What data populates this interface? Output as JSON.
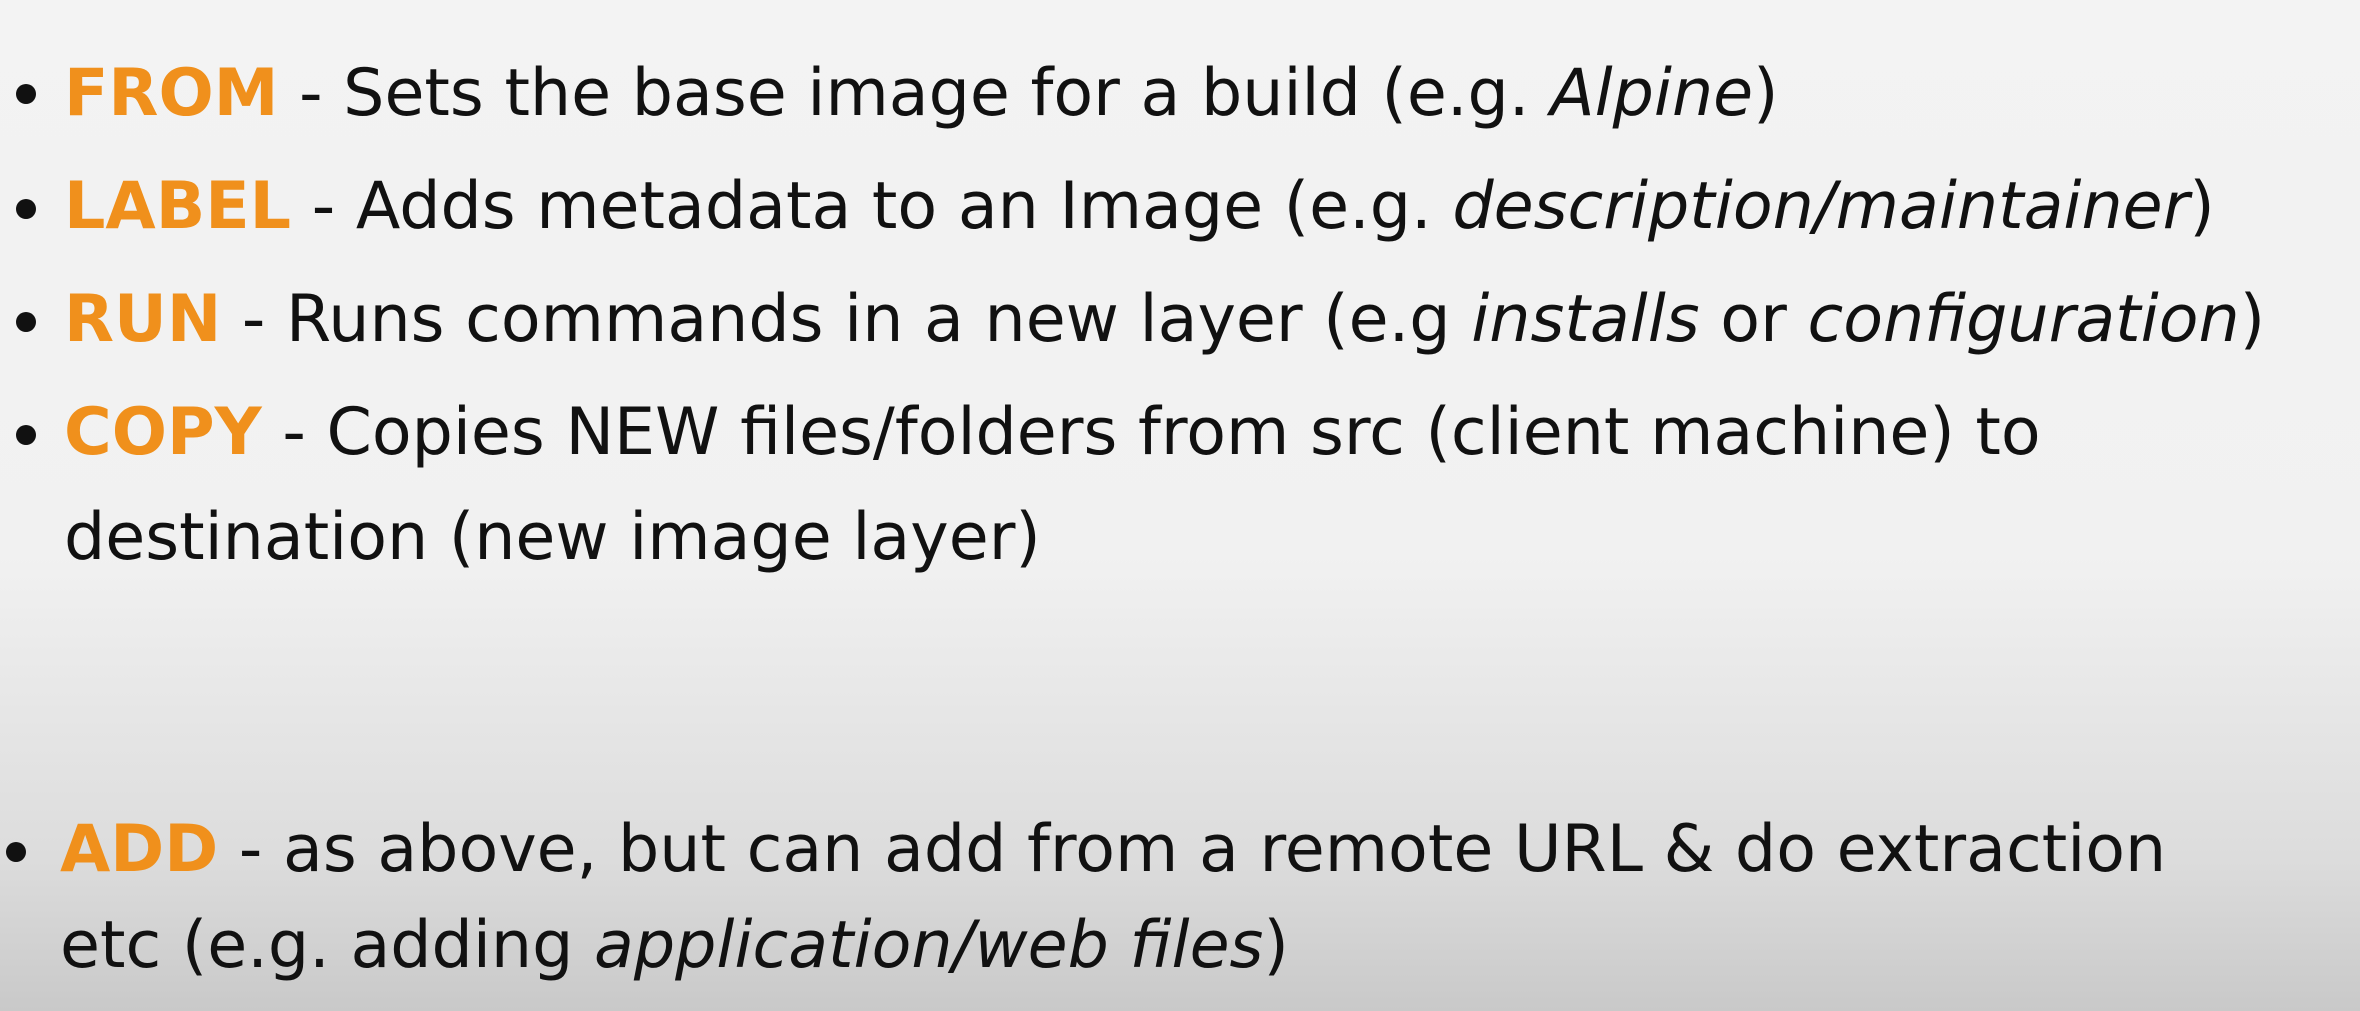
{
  "items": [
    {
      "keyword": "FROM",
      "text_before": " - Sets the base image for a build (e.g. ",
      "emphasis": "Alpine",
      "text_after": ")"
    },
    {
      "keyword": "LABEL",
      "text_before": " - Adds metadata to an Image (e.g. ",
      "emphasis": "description/maintainer",
      "text_after": ")"
    },
    {
      "keyword": "RUN",
      "text_before": " - Runs commands in a new layer (e.g ",
      "emphasis_1": "installs",
      "text_middle": " or ",
      "emphasis_2": "configuration",
      "text_after": ")"
    },
    {
      "keyword": "COPY",
      "text_line1": " - Copies NEW files/folders from src (client machine) to",
      "text_line2": "destination (new image layer)"
    },
    {
      "keyword": "ADD",
      "text_line1": " - as above, but can add from a remote URL & do extraction",
      "text_line2_before": "etc (e.g. adding ",
      "emphasis": "application/web files",
      "text_line2_after": ")"
    }
  ],
  "colors": {
    "keyword": "#f0901c",
    "text": "#111111",
    "background": "#f2f2f2"
  }
}
